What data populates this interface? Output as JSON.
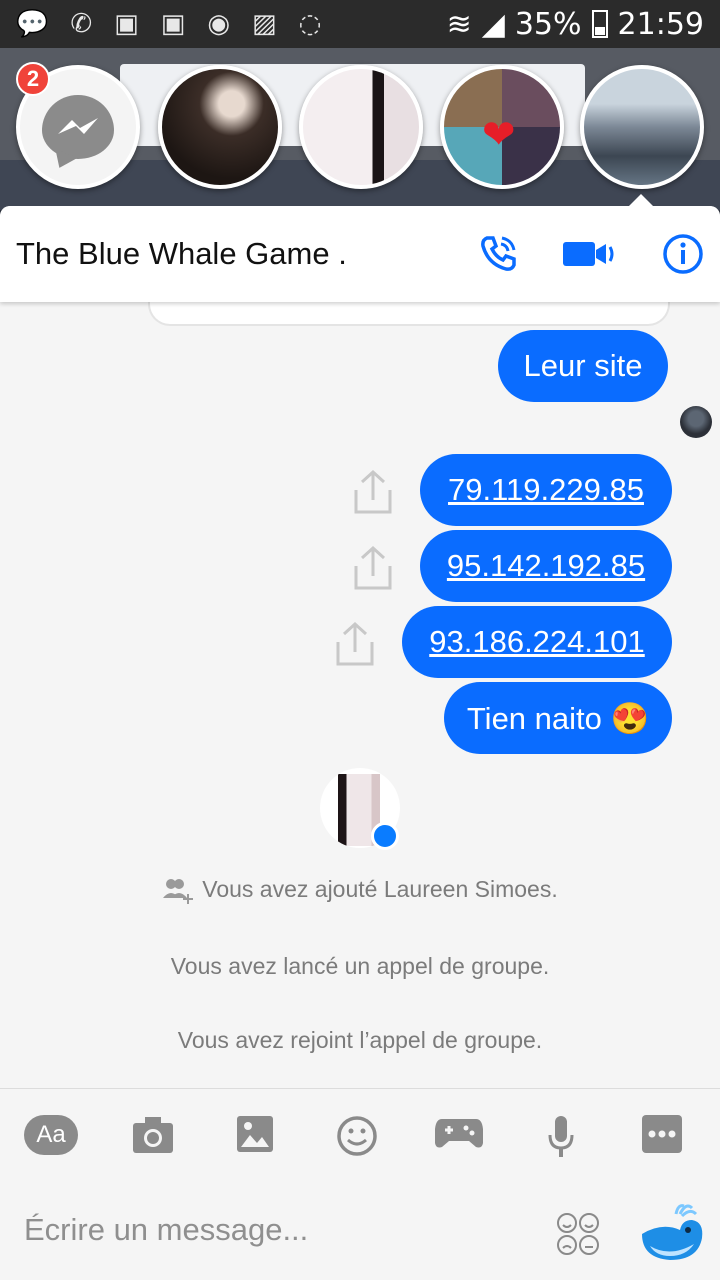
{
  "status_bar": {
    "battery": "35%",
    "time": "21:59"
  },
  "chat_heads": {
    "badge_count": "2"
  },
  "header": {
    "title": "The Blue Whale Game ."
  },
  "messages": [
    {
      "text": "Leur site",
      "link": false
    },
    {
      "text": "79.119.229.85",
      "link": true
    },
    {
      "text": "95.142.192.85",
      "link": true
    },
    {
      "text": "93.186.224.101",
      "link": true
    },
    {
      "text": "Tien naito 😍",
      "link": false
    }
  ],
  "system_messages": [
    "Vous avez ajouté Laureen Simoes.",
    "Vous avez lancé un appel de groupe.",
    "Vous avez rejoint l’appel de groupe."
  ],
  "toolbar": {
    "aa_label": "Aa"
  },
  "composer": {
    "placeholder": "Écrire un message..."
  },
  "colors": {
    "accent": "#0a6cff",
    "bubble_text": "#ffffff",
    "system_text": "#7b7b7b"
  }
}
